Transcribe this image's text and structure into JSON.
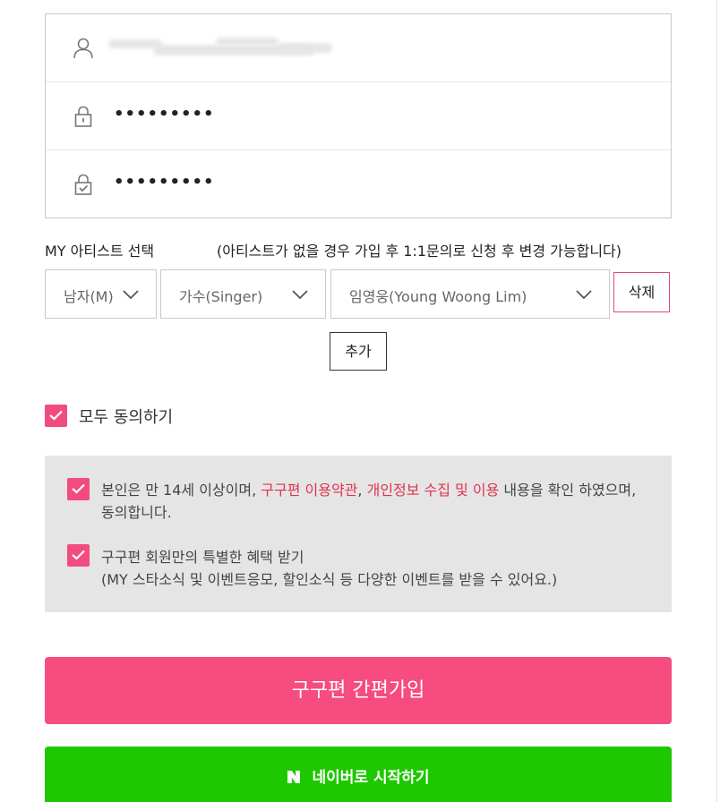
{
  "credentials": {
    "password_value": "•••••••••",
    "password_confirm_value": "•••••••••"
  },
  "artist": {
    "label": "MY 아티스트 선택",
    "note": "(아티스트가 없을 경우 가입 후 1:1문의로 신청 후 변경 가능합니다)",
    "gender_selected": "남자(M)",
    "type_selected": "가수(Singer)",
    "artist_selected": "임영웅(Young Woong Lim)",
    "delete_label": "삭제",
    "add_label": "추가"
  },
  "agreements": {
    "agree_all_label": "모두 동의하기",
    "term1": {
      "prefix": "본인은 만 14세 이상이며, ",
      "link1": "구구편 이용약관",
      "sep": ", ",
      "link2": "개인정보 수집 및 이용",
      "suffix": " 내용을 확인 하였으며, 동의합니다."
    },
    "term2_title": "구구편 회원만의 특별한 혜택 받기",
    "term2_sub": "(MY 스타소식 및 이벤트응모, 할인소식 등 다양한 이벤트를 받을 수 있어요.)"
  },
  "buttons": {
    "signup_label": "구구편 간편가입",
    "naver_label": "네이버로 시작하기"
  },
  "colors": {
    "accent_pink": "#f64c80",
    "checkbox_pink": "#f24b7f",
    "link_red": "#e0314f",
    "naver_green": "#1ec800"
  },
  "icons": {
    "user": "user-icon",
    "lock": "lock-icon",
    "lock_check": "lock-check-icon",
    "chevron": "chevron-down-icon",
    "checkmark": "checkmark-icon",
    "naver": "naver-logo-icon"
  }
}
